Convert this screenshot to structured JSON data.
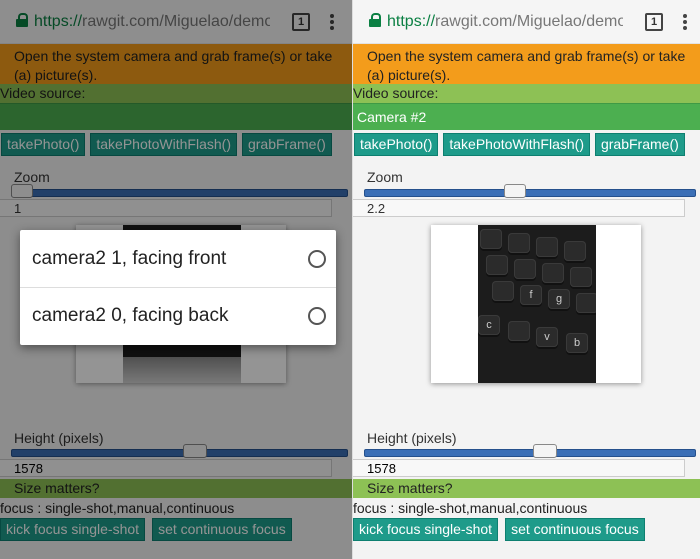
{
  "browser": {
    "url_protocol": "https://",
    "url_rest": "rawgit.com/Miguelao/demos/",
    "tab_count": "1"
  },
  "page": {
    "intro": "Open the system camera and grab frame(s) or take (a) picture(s).",
    "video_source_label": "Video source:",
    "buttons": {
      "take_photo": "takePhoto()",
      "take_photo_flash": "takePhotoWithFlash()",
      "grab_frame": "grabFrame()"
    },
    "zoom_label": "Zoom",
    "height_label": "Height (pixels)",
    "height_value": "1578",
    "size_matters": "Size matters?",
    "focus_text": "focus : single-shot,manual,continuous",
    "kick_focus": "kick focus single-shot",
    "continuous_focus": "set continuous focus",
    "keys": {
      "f": "f",
      "g": "g",
      "c": "c",
      "v": "v",
      "b": "b"
    }
  },
  "left": {
    "camera_selected": "",
    "zoom_value": "1",
    "zoom_level": 0.0,
    "height_level": 0.55,
    "dialog": {
      "options": [
        "camera2 1, facing front",
        "camera2 0, facing back"
      ]
    }
  },
  "right": {
    "camera_selected": "Camera #2",
    "zoom_value": "2.2",
    "zoom_level": 0.45,
    "height_level": 0.55
  }
}
